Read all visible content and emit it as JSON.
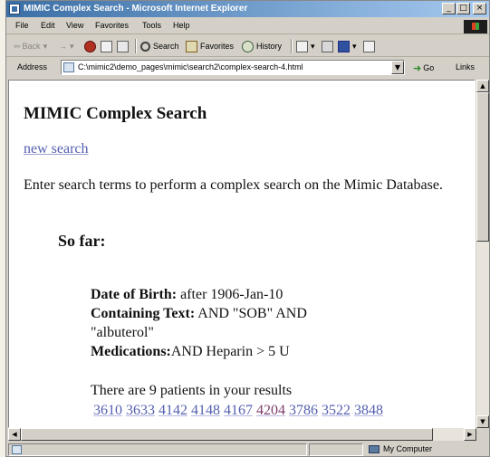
{
  "window": {
    "title": "MIMIC Complex Search - Microsoft Internet Explorer",
    "controls": [
      "_",
      "□",
      "×"
    ]
  },
  "menu": [
    "File",
    "Edit",
    "View",
    "Favorites",
    "Tools",
    "Help"
  ],
  "toolbar": {
    "back": "Back",
    "forward": "→",
    "search": "Search",
    "favorites": "Favorites",
    "history": "History"
  },
  "address": {
    "label": "Address",
    "url": "C:\\mimic2\\demo_pages\\mimic\\search2\\complex-search-4.html",
    "go": "Go",
    "links": "Links"
  },
  "page": {
    "title": "MIMIC Complex Search",
    "new_search": "new search",
    "intro": "Enter search terms to perform a complex search on the Mimic Database.",
    "so_far": "So far:",
    "criteria": {
      "dob_label": "Date of Birth:",
      "dob_value": " after 1906-Jan-10",
      "text_label": "Containing Text:",
      "text_value": " AND \"SOB\" AND \"albuterol\"",
      "med_label": "Medications:",
      "med_value": "AND Heparin > 5 U"
    },
    "results_line": "There are 9 patients in your results",
    "patient_ids": [
      "3610",
      "3633",
      "4142",
      "4148",
      "4167",
      "4204",
      "3786",
      "3522",
      "3848"
    ]
  },
  "status": {
    "zone": "My Computer"
  }
}
